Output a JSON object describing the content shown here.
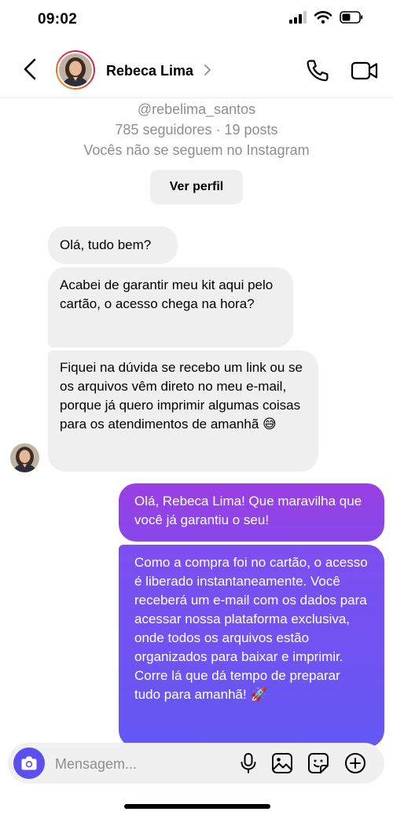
{
  "status_bar": {
    "time": "09:02"
  },
  "header": {
    "name": "Rebeca Lima"
  },
  "profile": {
    "handle": "@rebelima_santos",
    "stats": "785 seguidores · 19 posts",
    "follow_note": "Vocês não se seguem no Instagram",
    "view_profile_label": "Ver perfil"
  },
  "messages": [
    {
      "from": "them",
      "text": "Olá, tudo bem?"
    },
    {
      "from": "them",
      "text": " Acabei de garantir meu kit aqui pelo cartão, o acesso chega na hora?"
    },
    {
      "from": "them",
      "text": " Fiquei na dúvida se recebo um link ou se os arquivos vêm direto no meu e-mail, porque já quero imprimir algumas coisas para os atendimentos de amanhã 😅"
    },
    {
      "from": "me",
      "text": "Olá, Rebeca Lima! Que maravilha que você já garantiu o seu!"
    },
    {
      "from": "me",
      "text": " Como a compra foi no cartão, o acesso é liberado instantaneamente. Você receberá um e-mail com os dados para acessar nossa plataforma exclusiva, onde todos os arquivos estão organizados para baixar e imprimir. Corre lá que dá tempo de preparar tudo para amanhã! 🚀"
    }
  ],
  "composer": {
    "placeholder": "Mensagem..."
  },
  "icons": [
    "back-arrow-icon",
    "chevron-right-icon",
    "phone-icon",
    "video-camera-icon",
    "camera-icon",
    "microphone-icon",
    "image-icon",
    "sticker-icon",
    "plus-circle-icon",
    "signal-icon",
    "wifi-icon",
    "battery-icon"
  ],
  "colors": {
    "accent": "#5b4ff0",
    "outgoing_top": "#9a3fe3",
    "outgoing_bottom": "#6358f3",
    "incoming": "#efefef",
    "muted": "#8e8e8e"
  }
}
